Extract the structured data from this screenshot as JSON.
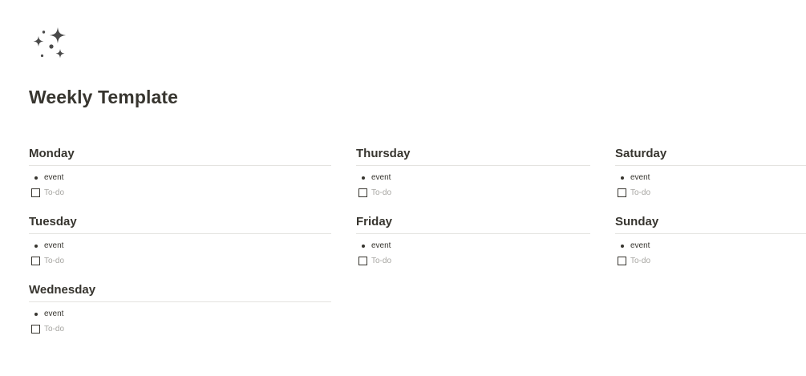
{
  "page": {
    "icon": "sparkles-icon",
    "title": "Weekly Template"
  },
  "columns": [
    {
      "days": [
        {
          "name": "Monday",
          "event": "event",
          "todo_placeholder": "To-do"
        },
        {
          "name": "Tuesday",
          "event": "event",
          "todo_placeholder": "To-do"
        },
        {
          "name": "Wednesday",
          "event": "event",
          "todo_placeholder": "To-do"
        }
      ]
    },
    {
      "days": [
        {
          "name": "Thursday",
          "event": "event",
          "todo_placeholder": "To-do"
        },
        {
          "name": "Friday",
          "event": "event",
          "todo_placeholder": "To-do"
        }
      ]
    },
    {
      "days": [
        {
          "name": "Saturday",
          "event": "event",
          "todo_placeholder": "To-do"
        },
        {
          "name": "Sunday",
          "event": "event",
          "todo_placeholder": "To-do"
        }
      ]
    }
  ],
  "colors": {
    "text": "#37352f",
    "placeholder": "#a6a5a1",
    "divider": "#e4e3e0",
    "icon": "#4a4a4a"
  }
}
